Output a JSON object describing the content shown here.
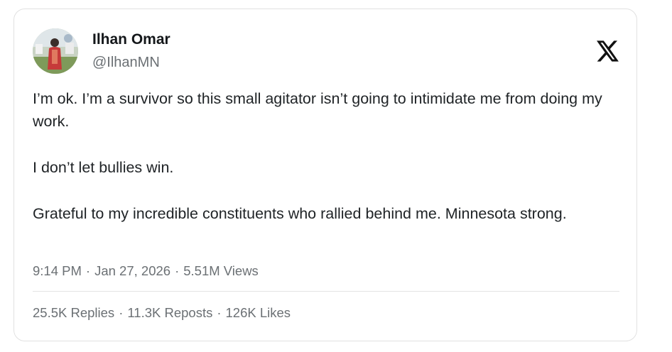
{
  "author": {
    "display_name": "Ilhan Omar",
    "handle": "@IlhanMN"
  },
  "platform_logo": "x-logo-icon",
  "tweet": {
    "paragraphs": [
      "I’m ok. I’m a survivor so this small agitator isn’t going to intimidate me from doing my work.",
      "I don’t let bullies win.",
      "Grateful to my incredible constituents who rallied behind me. Minnesota strong."
    ],
    "time": "9:14 PM",
    "date": "Jan 27, 2026",
    "views": "5.51M Views"
  },
  "stats": {
    "replies": "25.5K Replies",
    "reposts": "11.3K Reposts",
    "likes": "126K Likes",
    "separator": "·"
  },
  "colors": {
    "text": "#1f2326",
    "muted": "#6b7074",
    "border": "#e1e1e1"
  }
}
